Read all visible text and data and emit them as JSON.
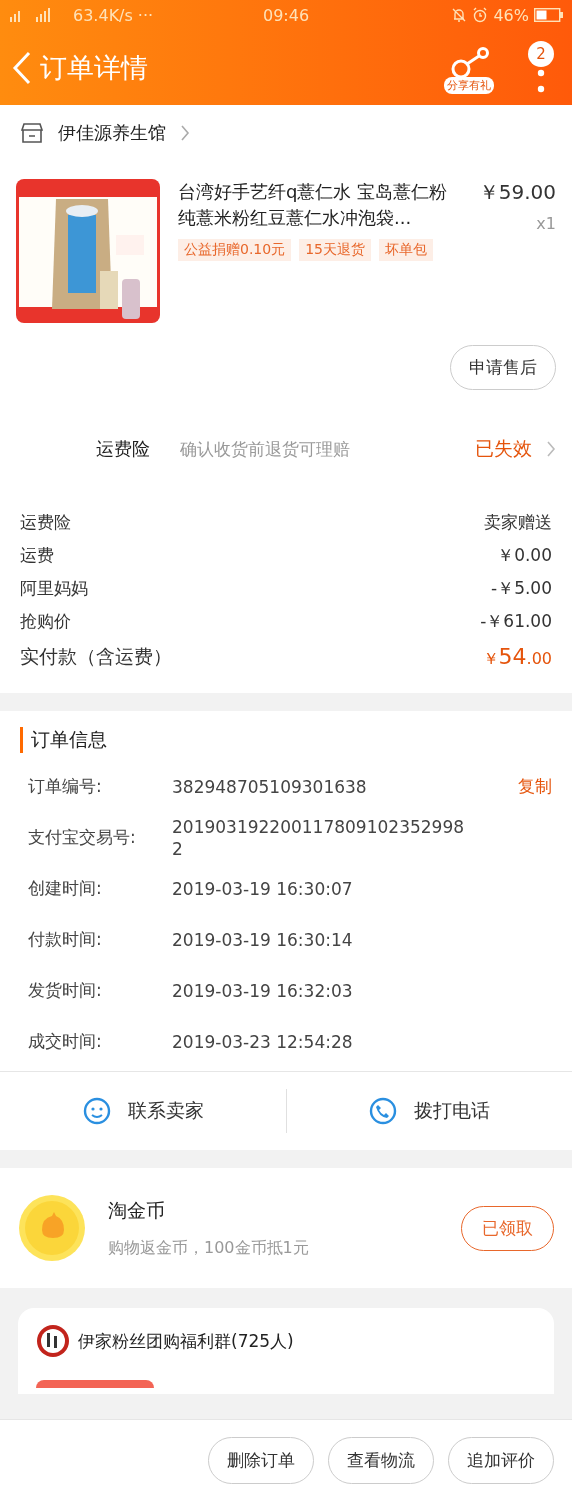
{
  "status_bar": {
    "net_speed": "63.4K/s",
    "more": "···",
    "time": "09:46",
    "battery": "46%"
  },
  "header": {
    "title": "订单详情",
    "share_label": "分享有礼",
    "badge": "2"
  },
  "shop": {
    "name": "伊佳源养生馆"
  },
  "product": {
    "title": "台湾好手艺纤q薏仁水 宝岛薏仁粉纯薏米粉红豆薏仁水冲泡袋...",
    "price": "￥59.00",
    "qty": "x1",
    "tags": [
      "公益捐赠0.10元",
      "15天退货",
      "坏单包"
    ],
    "kind": "picture"
  },
  "after_sale_button": "申请售后",
  "insurance": {
    "label": "运费险",
    "desc": "确认收货前退货可理赔",
    "status": "已失效"
  },
  "fees": [
    {
      "label": "运费险",
      "value": "卖家赠送"
    },
    {
      "label": "运费",
      "value": "￥0.00"
    },
    {
      "label": "阿里妈妈",
      "value": "-￥5.00"
    },
    {
      "label": "抢购价",
      "value": "-￥61.00"
    }
  ],
  "total": {
    "label": "实付款（含运费）",
    "currency": "￥",
    "integer": "54",
    "decimal": ".00"
  },
  "order_info": {
    "title": "订单信息",
    "copy": "复制",
    "rows": [
      {
        "label": "订单编号:",
        "value": "382948705109301638"
      },
      {
        "label": "支付宝交易号:",
        "value": "2019031922001178091023529982"
      },
      {
        "label": "创建时间:",
        "value": "2019-03-19 16:30:07"
      },
      {
        "label": "付款时间:",
        "value": "2019-03-19 16:30:14"
      },
      {
        "label": "发货时间:",
        "value": "2019-03-19 16:32:03"
      },
      {
        "label": "成交时间:",
        "value": "2019-03-23 12:54:28"
      }
    ]
  },
  "contact": [
    {
      "kind": "chat",
      "label": "联系卖家"
    },
    {
      "kind": "phone",
      "label": "拨打电话"
    }
  ],
  "coins": {
    "title": "淘金币",
    "desc": "购物返金币，100金币抵1元",
    "button": "已领取"
  },
  "group": {
    "name": "伊家粉丝团购福利群(725人)"
  },
  "actions": [
    "删除订单",
    "查看物流",
    "追加评价"
  ]
}
